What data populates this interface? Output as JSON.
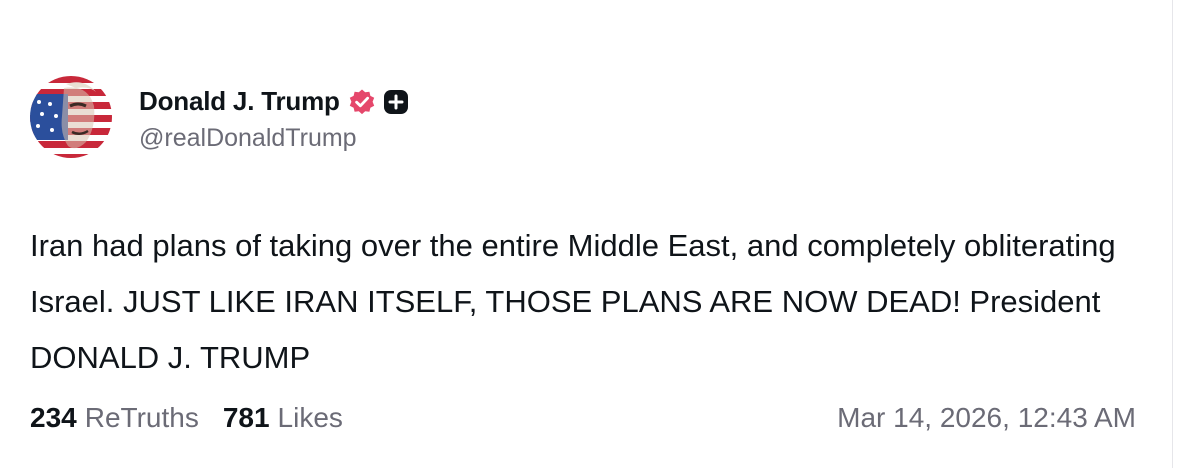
{
  "author": {
    "display_name": "Donald J. Trump",
    "handle": "@realDonaldTrump",
    "avatar_icon": "flag-portrait-avatar",
    "verified_icon": "verified-badge-icon",
    "badge_icon": "plus-badge-icon",
    "verified_color": "#e5476b"
  },
  "post": {
    "text": "Iran had plans of taking over the entire Middle East, and completely obliterating Israel. JUST LIKE IRAN ITSELF, THOSE PLANS ARE NOW DEAD! President DONALD J. TRUMP"
  },
  "stats": {
    "retruths_count": "234",
    "retruths_label": "ReTruths",
    "likes_count": "781",
    "likes_label": "Likes"
  },
  "timestamp": "Mar 14, 2026, 12:43 AM"
}
